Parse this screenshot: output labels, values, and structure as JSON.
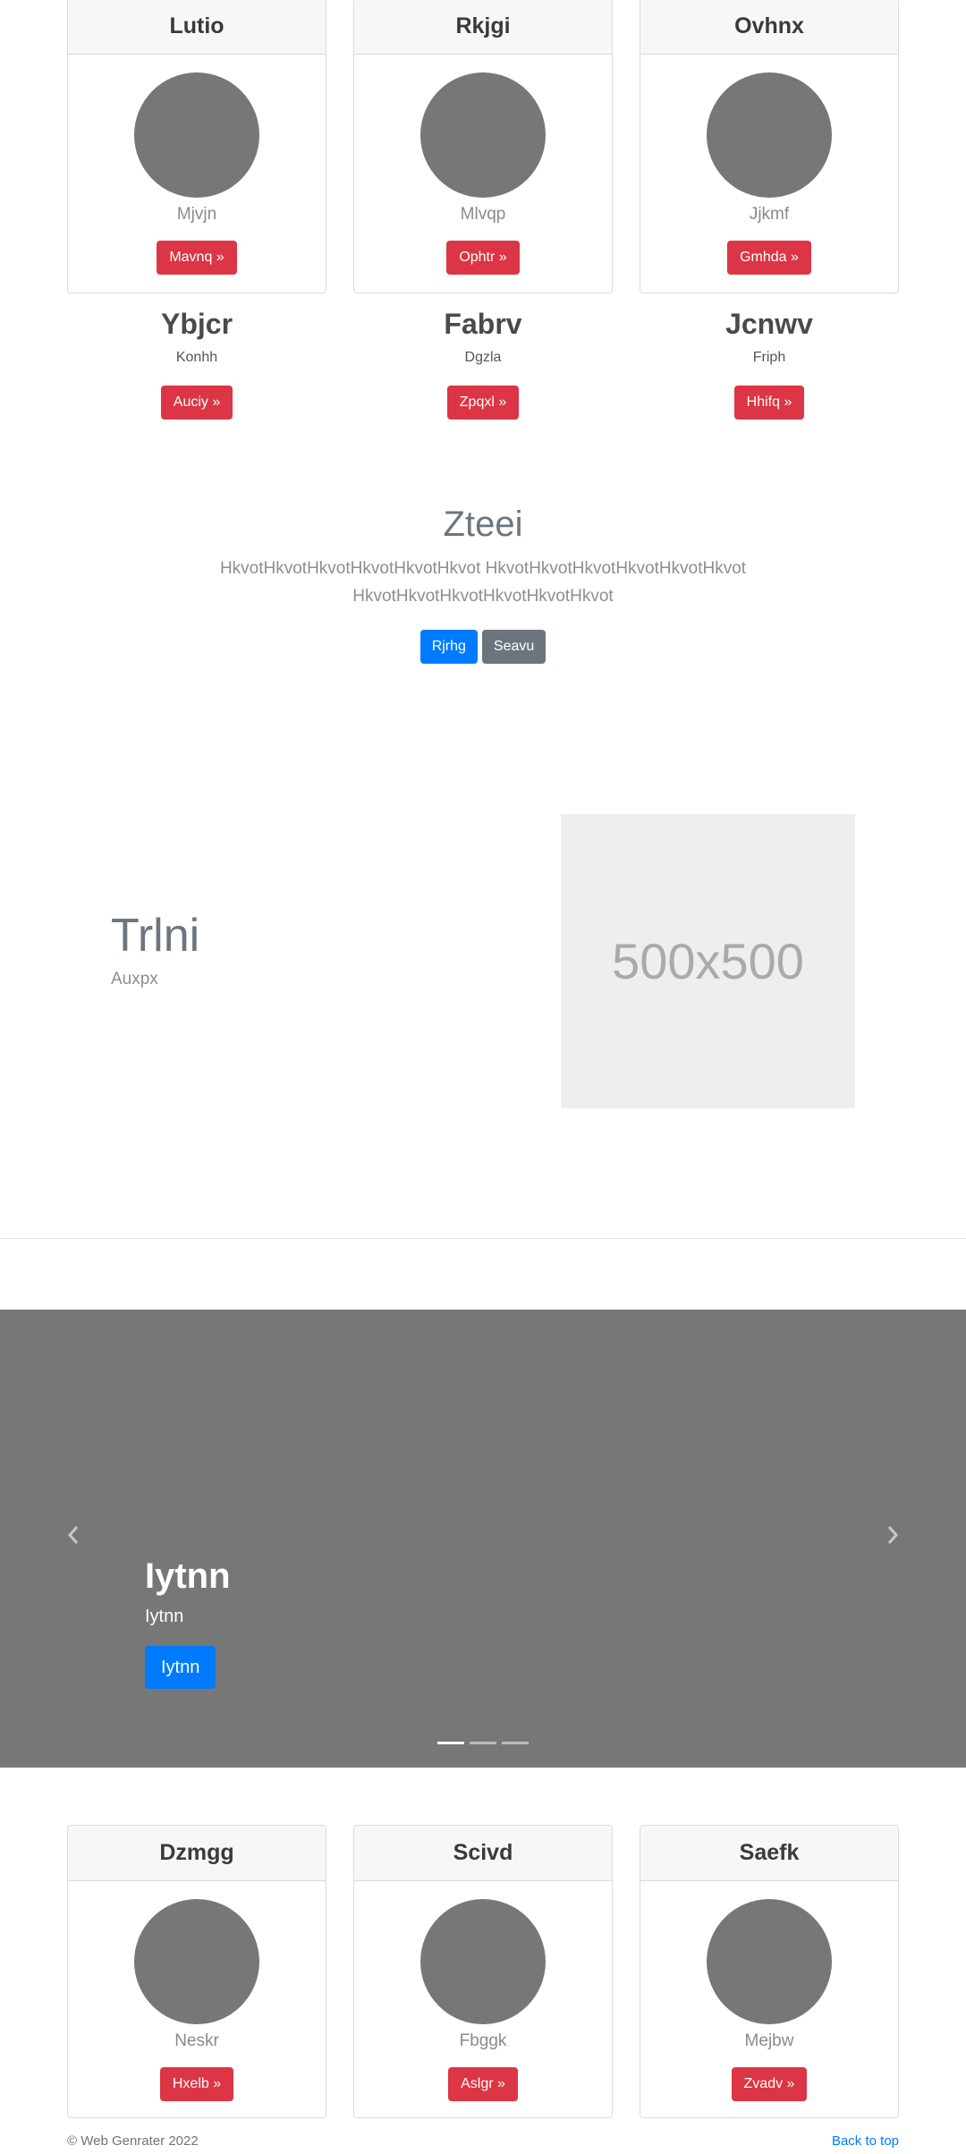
{
  "top_cards": [
    {
      "title": "Lutio",
      "subtitle": "Mjvjn",
      "button": "Mavnq »"
    },
    {
      "title": "Rkjgi",
      "subtitle": "Mlvqp",
      "button": "Ophtr »"
    },
    {
      "title": "Ovhnx",
      "subtitle": "Jjkmf",
      "button": "Gmhda »"
    }
  ],
  "features": [
    {
      "title": "Ybjcr",
      "subtitle": "Konhh",
      "button": "Auciy »"
    },
    {
      "title": "Fabrv",
      "subtitle": "Dgzla",
      "button": "Zpqxl »"
    },
    {
      "title": "Jcnwv",
      "subtitle": "Friph",
      "button": "Hhifq »"
    }
  ],
  "hero": {
    "title": "Zteei",
    "lead": "HkvotHkvotHkvotHkvotHkvotHkvot HkvotHkvotHkvotHkvotHkvotHkvot HkvotHkvotHkvotHkvotHkvotHkvot",
    "primary_button": "Rjrhg",
    "secondary_button": "Seavu"
  },
  "featurette": {
    "heading": "Trlni",
    "lead": "Auxpx",
    "image_label": "500x500"
  },
  "carousel": {
    "title": "Iytnn",
    "text": "Iytnn",
    "button": "Iytnn",
    "prev_icon": "chevron-left-icon",
    "next_icon": "chevron-right-icon",
    "slide_count": 3,
    "active_slide": 0
  },
  "bottom_cards": [
    {
      "title": "Dzmgg",
      "subtitle": "Neskr",
      "button": "Hxelb »"
    },
    {
      "title": "Scivd",
      "subtitle": "Fbggk",
      "button": "Aslgr »"
    },
    {
      "title": "Saefk",
      "subtitle": "Mejbw",
      "button": "Zvadv »"
    }
  ],
  "footer": {
    "copyright": "© Web Genrater 2022",
    "back_to_top": "Back to top"
  },
  "colors": {
    "danger": "#dc3545",
    "primary": "#007bff",
    "secondary": "#6c757d",
    "carousel_bg": "#777777"
  }
}
